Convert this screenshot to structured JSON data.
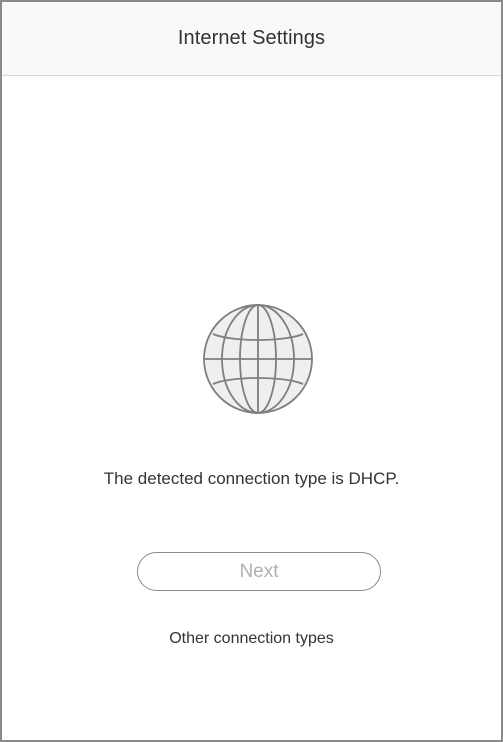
{
  "header": {
    "title": "Internet Settings"
  },
  "status": {
    "icon": "globe-icon",
    "message": "The detected connection type is DHCP."
  },
  "actions": {
    "next_label": "Next",
    "other_types_label": "Other connection types"
  },
  "colors": {
    "border": "#8a8a8a",
    "header_background": "#f9f9f9",
    "icon_fill": "#efefef",
    "icon_stroke": "#7f7f7f",
    "disabled_text": "#b0b0b0"
  }
}
